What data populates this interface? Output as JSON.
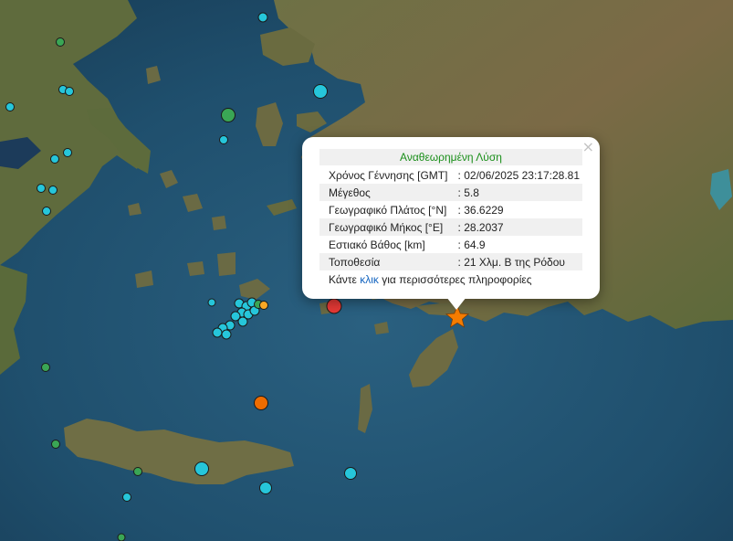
{
  "popup": {
    "title": "Αναθεωρημένη Λύση",
    "close": "×",
    "rows": [
      {
        "label": "Χρόνος Γέννησης [GMT]",
        "value": ": 02/06/2025 23:17:28.81"
      },
      {
        "label": "Μέγεθος",
        "value": ": 5.8"
      },
      {
        "label": "Γεωγραφικό Πλάτος [°N]",
        "value": ": 36.6229"
      },
      {
        "label": "Γεωγραφικό Μήκος [°E]",
        "value": ": 28.2037"
      },
      {
        "label": "Εστιακό Βάθος [km]",
        "value": ": 64.9"
      },
      {
        "label": "Τοποθεσία",
        "value": ": 21 Χλμ. Β της Ρόδου"
      }
    ],
    "more_prefix": "Κάντε ",
    "more_link": "κλικ",
    "more_suffix": " για περισσότερες πληροφορίες"
  },
  "colors": {
    "cyan": "#26c6da",
    "green": "#3aa655",
    "orange": "#ef6c00",
    "red": "#e53935",
    "yellow": "#f9a825",
    "star": "#f57c00",
    "sea": "#1d4a66",
    "land": "#5d6a3c"
  },
  "main_event": {
    "icon": "star-icon",
    "magnitude": 5.8
  }
}
